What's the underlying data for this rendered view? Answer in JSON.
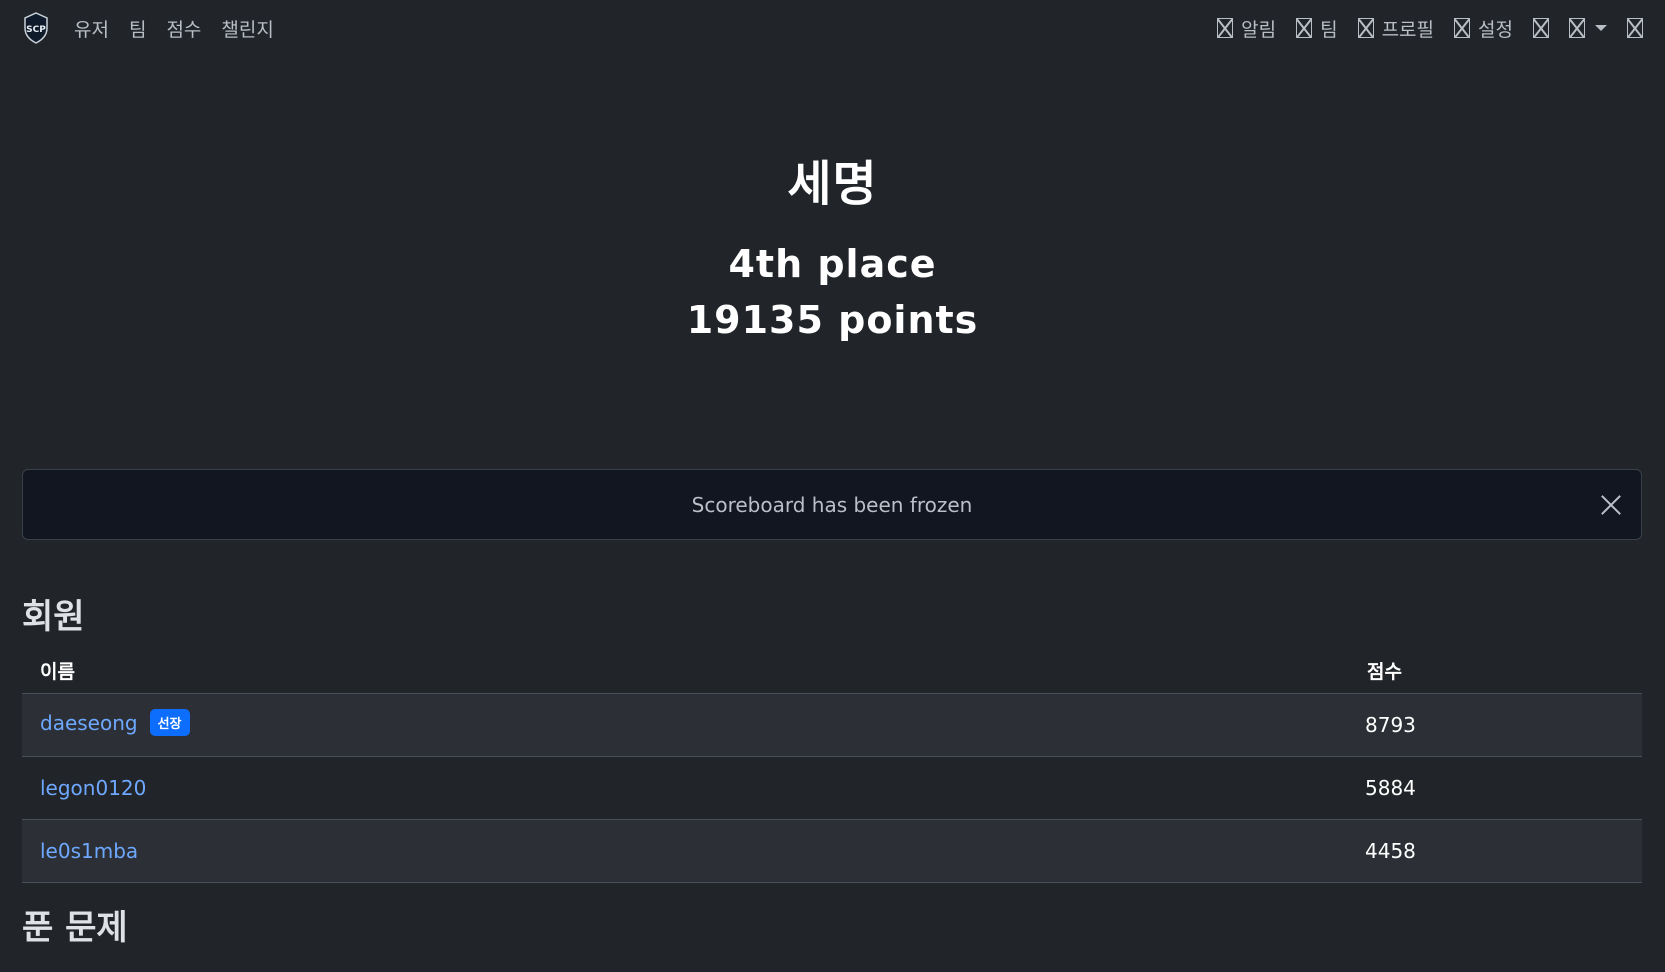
{
  "nav": {
    "logo_text": "SCP",
    "left": [
      "유저",
      "팀",
      "점수",
      "챌린지"
    ],
    "right": [
      {
        "label": "알림",
        "icon": "bell-icon"
      },
      {
        "label": "팀",
        "icon": "team-icon"
      },
      {
        "label": "프로필",
        "icon": "profile-icon"
      },
      {
        "label": "설정",
        "icon": "settings-icon"
      }
    ]
  },
  "team": {
    "name": "세명",
    "place": "4th place",
    "points": "19135 points"
  },
  "alert": {
    "message": "Scoreboard has been frozen"
  },
  "members": {
    "title": "회원",
    "columns": {
      "name": "이름",
      "score": "점수"
    },
    "rows": [
      {
        "name": "daeseong",
        "badge": "선장",
        "score": "8793"
      },
      {
        "name": "legon0120",
        "badge": "",
        "score": "5884"
      },
      {
        "name": "le0s1mba",
        "badge": "",
        "score": "4458"
      }
    ]
  },
  "solves": {
    "title": "푼 문제"
  },
  "colors": {
    "background": "#212529",
    "link": "#6ea8fe",
    "badge": "#0d6efd"
  }
}
